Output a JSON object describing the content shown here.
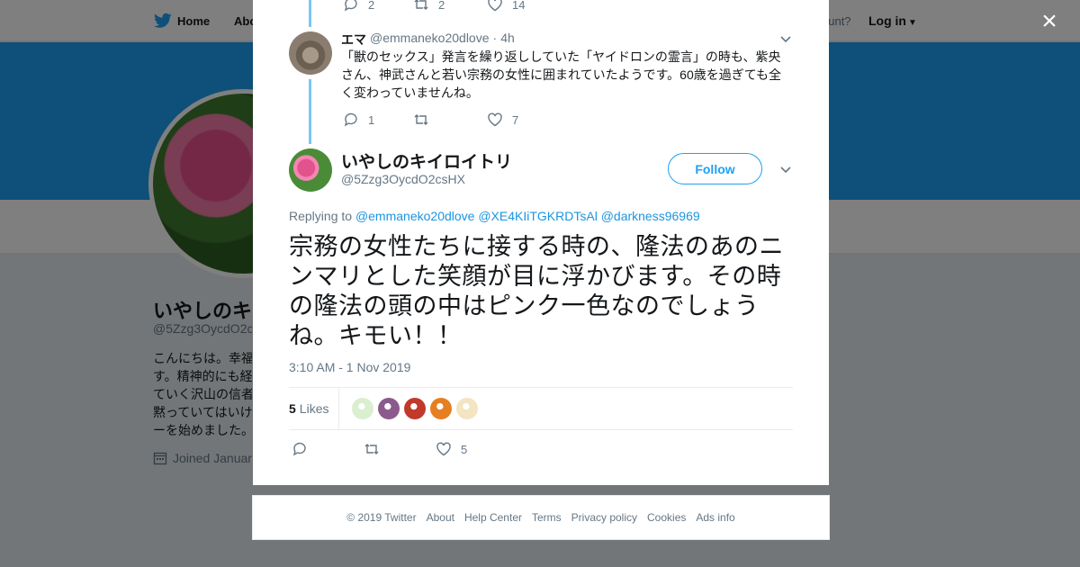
{
  "topbar": {
    "home_label": "Home",
    "about_label": "Abo",
    "have_account": "ccount?",
    "login_label": "Log in"
  },
  "profile": {
    "name": "いやしのキ",
    "handle": "@5Zzg3OycdO2c",
    "bio_lines": [
      "こんにちは。幸福",
      "す。精神的にも経",
      "ていく沢山の信者",
      "黙っていてはいけ",
      "ーを始めました。"
    ],
    "joined": "Joined Januar"
  },
  "modal": {
    "close_label": "×",
    "prev_tweet_actions": {
      "replies": "2",
      "retweets": "2",
      "likes": "14"
    },
    "reply": {
      "name": "エマ",
      "handle": "@emmaneko20dlove",
      "separator": "·",
      "time": "4h",
      "text": "「獣のセックス」発言を繰り返ししていた「ヤイドロンの霊言」の時も、紫央さん、神武さんと若い宗務の女性に囲まれていたようです。60歳を過ぎても全く変わっていませんね。",
      "replies": "1",
      "retweets": "",
      "likes": "7"
    },
    "main": {
      "name": "いやしのキイロイトリ",
      "handle": "@5Zzg3OycdO2csHX",
      "follow_label": "Follow",
      "replying_prefix": "Replying to",
      "replying_to": [
        "@emmaneko20dlove",
        "@XE4KIiTGKRDTsAl",
        "@darkness96969"
      ],
      "text": "宗務の女性たちに接する時の、隆法のあのニンマリとした笑顔が目に浮かびます。その時の隆法の頭の中はピンク一色なのでしょうね。キモい！！",
      "timestamp": "3:10 AM - 1 Nov 2019",
      "likes_count": "5",
      "likes_label": "Likes",
      "likers": [
        "liker-1",
        "liker-2",
        "liker-3",
        "liker-4",
        "liker-5"
      ],
      "liker_colors": [
        "#d9efcf",
        "#8b5a8c",
        "#c0392b",
        "#e67e22",
        "#f3e4c2"
      ],
      "replies": "",
      "retweets": "",
      "likes": "5"
    }
  },
  "footer": {
    "links": [
      "© 2019 Twitter",
      "About",
      "Help Center",
      "Terms",
      "Privacy policy",
      "Cookies",
      "Ads info"
    ]
  },
  "colors": {
    "accent": "#1da1f2",
    "link": "#1b95e0",
    "muted": "#657786"
  }
}
